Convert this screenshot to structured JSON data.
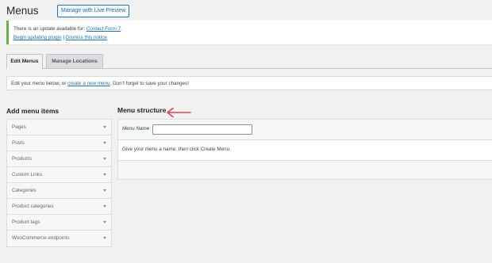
{
  "header": {
    "title": "Menus",
    "preview_button": "Manage with Live Preview"
  },
  "notice": {
    "line1_prefix": "There is an update available for: ",
    "plugin_name": "Contact Form 7",
    "line1_suffix": ".",
    "begin_link": "Begin updating plugin",
    "separator": " | ",
    "dismiss_link": "Dismiss this notice"
  },
  "tabs": [
    {
      "label": "Edit Menus",
      "active": true
    },
    {
      "label": "Manage Locations",
      "active": false
    }
  ],
  "intro": {
    "prefix": "Edit your menu below, or ",
    "link": "create a new menu",
    "suffix": ". Don’t forget to save your changes!"
  },
  "add_items": {
    "heading": "Add menu items",
    "items": [
      {
        "label": "Pages"
      },
      {
        "label": "Posts"
      },
      {
        "label": "Products"
      },
      {
        "label": "Custom Links"
      },
      {
        "label": "Categories"
      },
      {
        "label": "Product categories"
      },
      {
        "label": "Product tags"
      },
      {
        "label": "WooCommerce endpoints"
      }
    ]
  },
  "structure": {
    "heading": "Menu structure",
    "menu_name_label": "Menu Name",
    "menu_name_value": "",
    "instructions": "Give your menu a name, then click Create Menu."
  },
  "colors": {
    "accent": "#2271b1",
    "notice_border": "#72ae41",
    "annotation_arrow": "#e0435d"
  }
}
